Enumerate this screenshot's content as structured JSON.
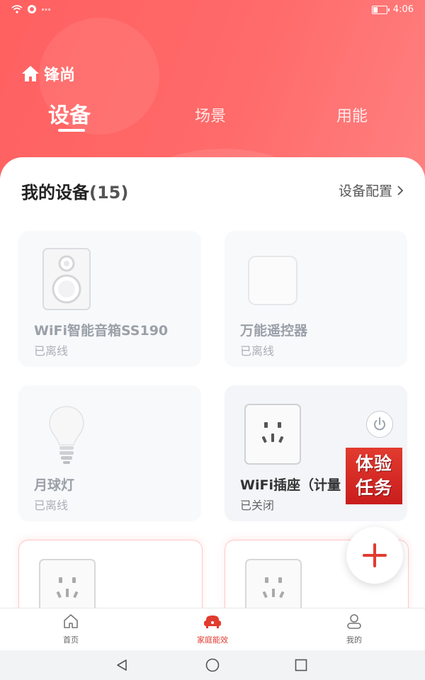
{
  "status_bar": {
    "time": "4:06"
  },
  "header": {
    "home_name": "锋尚",
    "tabs": [
      {
        "label": "设备",
        "active": true
      },
      {
        "label": "场景",
        "active": false
      },
      {
        "label": "用能",
        "active": false
      }
    ]
  },
  "devices_section": {
    "title": "我的设备",
    "count": "(15)",
    "config_label": "设备配置"
  },
  "devices": [
    {
      "name": "WiFi智能音箱SS190",
      "status": "已离线",
      "icon": "speaker-icon"
    },
    {
      "name": "万能遥控器",
      "status": "已离线",
      "icon": "remote-icon"
    },
    {
      "name": "月球灯",
      "status": "已离线",
      "icon": "bulb-icon"
    },
    {
      "name": "WiFi插座（计量",
      "status": "已关闭",
      "icon": "socket-icon"
    },
    {
      "name": "",
      "status": "",
      "icon": "socket-icon"
    },
    {
      "name": "",
      "status": "",
      "icon": "socket-icon"
    }
  ],
  "promo": {
    "line1": "体验",
    "line2": "任务"
  },
  "bottom_nav": [
    {
      "label": "首页",
      "icon": "home-icon",
      "active": false
    },
    {
      "label": "家庭能效",
      "icon": "sofa-icon",
      "active": true
    },
    {
      "label": "我的",
      "icon": "user-icon",
      "active": false
    }
  ],
  "colors": {
    "accent": "#e23b2f",
    "header": "#ff6464",
    "offline_text": "#9aa0a8"
  }
}
